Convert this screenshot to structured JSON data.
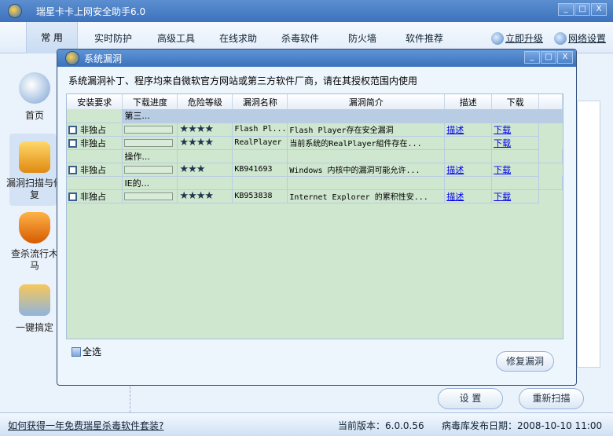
{
  "app": {
    "title": "瑞星卡卡上网安全助手6.0",
    "window_buttons": [
      "_",
      "□",
      "X"
    ]
  },
  "menu": {
    "items": [
      "常 用",
      "实时防护",
      "高级工具",
      "在线求助",
      "杀毒软件",
      "防火墙",
      "软件推荐"
    ],
    "upgrade": "立即升级",
    "network": "网络设置"
  },
  "sidebar": {
    "items": [
      "首页",
      "漏洞扫描与修复",
      "查杀流行木马",
      "一键搞定"
    ]
  },
  "dialog": {
    "title": "系统漏洞",
    "notice": "系统漏洞补丁、程序均来自微软官方网站或第三方软件厂商，请在其授权范围内使用",
    "columns": [
      "安装要求",
      "下载进度",
      "危险等级",
      "漏洞名称",
      "漏洞简介",
      "描述",
      "下载"
    ],
    "rows": [
      {
        "type": "group",
        "label": "第三..."
      },
      {
        "type": "item",
        "req": "非独占",
        "stars": "★★★★",
        "name": "Flash Pl...",
        "desc": "Flash Player存在安全漏洞",
        "describe": "描述",
        "download": "下载"
      },
      {
        "type": "item",
        "req": "非独占",
        "stars": "★★★★",
        "name": "RealPlayer",
        "desc": "当前系统的RealPlayer組件存在...",
        "describe": "",
        "download": "下载"
      },
      {
        "type": "sub",
        "label": "操作..."
      },
      {
        "type": "item",
        "req": "非独占",
        "stars": "★★★",
        "name": "KB941693",
        "desc": "Windows 内核中的漏洞可能允许...",
        "describe": "描述",
        "download": "下载"
      },
      {
        "type": "sub",
        "label": "IE的..."
      },
      {
        "type": "item",
        "req": "非独占",
        "stars": "★★★★",
        "name": "KB953838",
        "desc": "Internet Explorer 的累积性安...",
        "describe": "描述",
        "download": "下载"
      }
    ],
    "select_all": "全选",
    "repair": "修复漏洞"
  },
  "buttons": {
    "settings": "设 置",
    "rescan": "重新扫描"
  },
  "status": {
    "promo": "如何获得一年免费瑞星杀毒软件套装?",
    "version": "当前版本：6.0.0.56",
    "db_date": "病毒库发布日期：2008-10-10 11:00"
  }
}
